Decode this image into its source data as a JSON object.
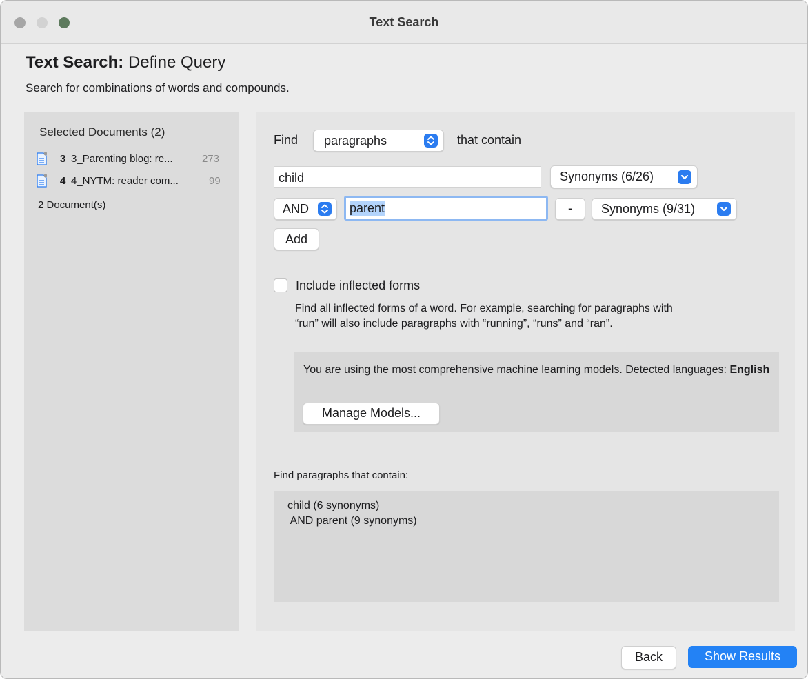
{
  "window": {
    "title": "Text Search"
  },
  "header": {
    "title_bold": "Text Search:",
    "title_rest": "Define Query",
    "subtitle": "Search for combinations of words and compounds."
  },
  "sidebar": {
    "title": "Selected Documents (2)",
    "documents": [
      {
        "number": "3",
        "name": "3_Parenting blog: re...",
        "count": "273",
        "icon": "document-icon"
      },
      {
        "number": "4",
        "name": "4_NYTM: reader com...",
        "count": "99",
        "icon": "document-icon"
      }
    ],
    "footer": "2 Document(s)"
  },
  "query": {
    "find_label": "Find",
    "scope_value": "paragraphs",
    "contain_label": "that contain",
    "terms": [
      {
        "operator": "",
        "value": "child",
        "synonyms": "Synonyms (6/26)"
      },
      {
        "operator": "AND",
        "value": "parent",
        "synonyms": "Synonyms (9/31)",
        "remove_label": "-"
      }
    ],
    "add_label": "Add"
  },
  "options": {
    "inflected_label": "Include inflected forms",
    "inflected_checked": false,
    "help_line1": "Find all inflected forms of a word. For example, searching for paragraphs with",
    "help_line2": "“run” will also include paragraphs with “running”, “runs” and “ran”."
  },
  "models": {
    "text": "You are using the most comprehensive machine learning models. Detected languages:",
    "language": "English",
    "manage_label": "Manage Models..."
  },
  "summary": {
    "label": "Find paragraphs that contain:",
    "lines": [
      "child (6 synonyms)",
      " AND parent (9 synonyms)"
    ]
  },
  "footer": {
    "back_label": "Back",
    "show_results_label": "Show Results"
  },
  "colors": {
    "accent": "#2382f5",
    "panel": "#dcdcdc"
  }
}
